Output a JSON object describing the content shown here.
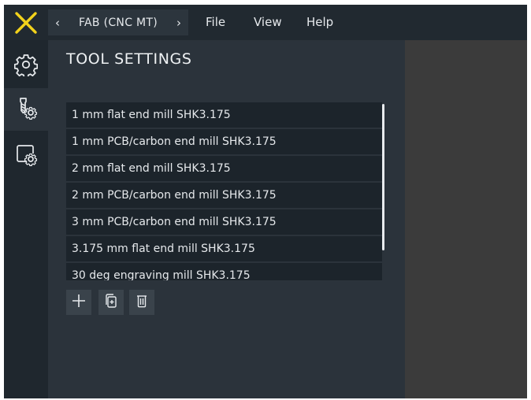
{
  "colors": {
    "accent": "#f2d21b",
    "background": "#2b333b",
    "topbar": "#212930",
    "sidebar": "#1f272e",
    "list_row": "#1c242b",
    "right_pane": "#3b3b3b",
    "text": "#e6e9ec"
  },
  "header": {
    "logo_icon": "x-logo-icon",
    "breadcrumb": {
      "prev_icon": "chevron-left-icon",
      "label": "FAB (CNC MT)",
      "next_icon": "chevron-right-icon"
    },
    "menu": [
      {
        "label": "File"
      },
      {
        "label": "View"
      },
      {
        "label": "Help"
      }
    ]
  },
  "sidebar": {
    "items": [
      {
        "icon": "gear-settings-icon",
        "active": false
      },
      {
        "icon": "tool-settings-icon",
        "active": true
      },
      {
        "icon": "machine-settings-icon",
        "active": false
      }
    ]
  },
  "panel": {
    "title": "TOOL SETTINGS",
    "tools": [
      {
        "label": "1 mm flat end mill SHK3.175"
      },
      {
        "label": "1 mm PCB/carbon end mill SHK3.175"
      },
      {
        "label": "2 mm flat end mill SHK3.175"
      },
      {
        "label": "2 mm PCB/carbon end mill SHK3.175"
      },
      {
        "label": "3 mm PCB/carbon end mill SHK3.175"
      },
      {
        "label": "3.175 mm flat end mill SHK3.175"
      },
      {
        "label": "30 deg engraving mill SHK3.175"
      }
    ],
    "actions": [
      {
        "icon": "add-icon"
      },
      {
        "icon": "duplicate-icon"
      },
      {
        "icon": "delete-icon"
      }
    ]
  }
}
